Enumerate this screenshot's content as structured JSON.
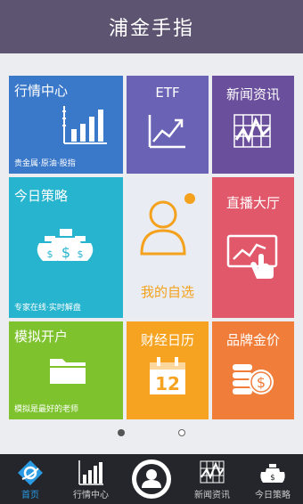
{
  "header": {
    "title": "浦金手指"
  },
  "tiles": {
    "market": {
      "title": "行情中心",
      "sub": "贵金属·原油·股指",
      "icon": "bar-chart-icon"
    },
    "etf": {
      "title": "ETF",
      "icon": "trend-line-icon"
    },
    "news": {
      "title": "新闻资讯",
      "icon": "news-chart-icon"
    },
    "strategy": {
      "title": "今日策略",
      "sub": "专家在线·实时解盘",
      "icon": "money-bags-icon"
    },
    "favorites": {
      "title": "我的自选",
      "icon": "user-icon"
    },
    "live": {
      "title": "直播大厅",
      "icon": "touch-screen-icon"
    },
    "simulate": {
      "title": "模拟开户",
      "sub": "模拟是最好的老师",
      "icon": "folder-icon"
    },
    "calendar": {
      "title": "财经日历",
      "day": "12",
      "icon": "calendar-icon"
    },
    "gold": {
      "title": "品牌金价",
      "icon": "coins-icon"
    }
  },
  "pager": {
    "active_index": 0,
    "count": 2
  },
  "tabbar": {
    "items": [
      {
        "label": "首页",
        "icon": "home-icon",
        "active": true
      },
      {
        "label": "行情中心",
        "icon": "bar-chart-icon"
      },
      {
        "label": "",
        "icon": "profile-icon"
      },
      {
        "label": "新闻资讯",
        "icon": "news-chart-icon"
      },
      {
        "label": "今日策略",
        "icon": "money-bags-icon"
      }
    ]
  },
  "colors": {
    "header": "#5c5470",
    "market": "#3a78c9",
    "etf": "#6a63b5",
    "news": "#6a4f9c",
    "strategy": "#27b4cf",
    "favorites_accent": "#f4a11d",
    "live": "#e1586b",
    "simulate": "#7ec32d",
    "calendar": "#f6a321",
    "gold": "#f07d3a",
    "tab_active": "#2a9be3"
  }
}
